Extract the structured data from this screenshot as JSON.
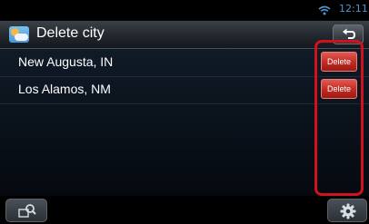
{
  "status_bar": {
    "time": "12:11",
    "wifi_icon": "wifi-icon"
  },
  "header": {
    "app_icon": "weather-icon",
    "title": "Delete city",
    "back_icon": "back-arrow-icon"
  },
  "cities": [
    {
      "name": "New Augusta, IN",
      "action_label": "Delete"
    },
    {
      "name": "Los Alamos, NM",
      "action_label": "Delete"
    }
  ],
  "bottom_bar": {
    "left_icon": "search-icon",
    "right_icon": "gear-icon"
  },
  "colors": {
    "delete_button": "#c02a22",
    "highlight_box": "#d0121f",
    "clock": "#4f93d0"
  }
}
